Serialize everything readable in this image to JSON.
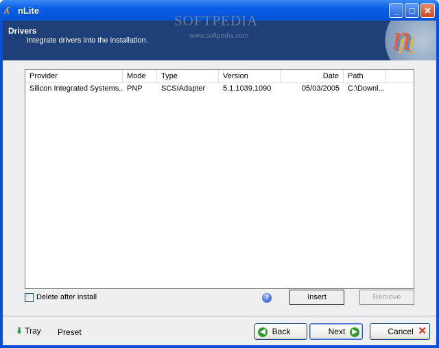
{
  "window": {
    "title": "nLite"
  },
  "header": {
    "title": "Drivers",
    "subtitle": "Integrate drivers into the installation.",
    "watermark": "SOFTPEDIA",
    "watermark_url": "www.softpedia.com"
  },
  "list": {
    "columns": [
      "Provider",
      "Mode",
      "Type",
      "Version",
      "Date",
      "Path"
    ],
    "rows": [
      [
        "Silicon Integrated Systems...",
        "PNP",
        "SCSIAdapter",
        "5.1.1039.1090",
        "05/03/2005",
        "C:\\Downl..."
      ]
    ]
  },
  "options": {
    "delete_after_install": "Delete after install",
    "delete_checked": false,
    "help": "?"
  },
  "buttons": {
    "insert": "Insert",
    "remove": "Remove",
    "tray": "Tray",
    "preset": "Preset",
    "back": "Back",
    "next": "Next",
    "cancel": "Cancel"
  }
}
